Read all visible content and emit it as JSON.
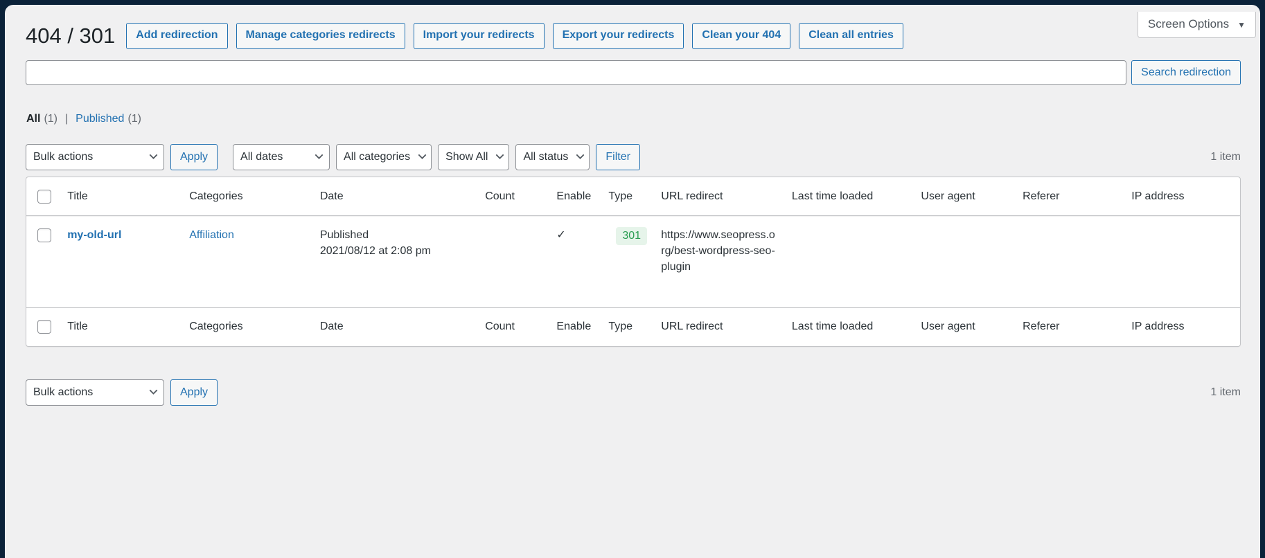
{
  "screen_options": {
    "label": "Screen Options",
    "caret_icon": "chevron-down-icon"
  },
  "header": {
    "title": "404 / 301",
    "actions": [
      "Add redirection",
      "Manage categories redirects",
      "Import your redirects",
      "Export your redirects",
      "Clean your 404",
      "Clean all entries"
    ]
  },
  "search": {
    "value": "",
    "placeholder": "",
    "button_label": "Search redirection"
  },
  "status_links": {
    "all": {
      "label": "All",
      "count": "(1)"
    },
    "separator": "|",
    "published": {
      "label": "Published",
      "count": "(1)"
    }
  },
  "tablenav_top": {
    "bulk_actions": "Bulk actions",
    "apply_label": "Apply",
    "dates": "All dates",
    "categories": "All categories",
    "show": "Show All",
    "status": "All status",
    "filter_label": "Filter",
    "displaying_num": "1 item"
  },
  "tablenav_bottom": {
    "bulk_actions": "Bulk actions",
    "apply_label": "Apply",
    "displaying_num": "1 item"
  },
  "table": {
    "columns": [
      {
        "label": "Title",
        "sortable": true
      },
      {
        "label": "Categories",
        "sortable": false
      },
      {
        "label": "Date",
        "sortable": true
      },
      {
        "label": "Count",
        "sortable": true
      },
      {
        "label": "Enable",
        "sortable": true
      },
      {
        "label": "Type",
        "sortable": true
      },
      {
        "label": "URL redirect",
        "sortable": false
      },
      {
        "label": "Last time loaded",
        "sortable": false
      },
      {
        "label": "User agent",
        "sortable": false
      },
      {
        "label": "Referer",
        "sortable": false
      },
      {
        "label": "IP address",
        "sortable": false
      }
    ],
    "rows": [
      {
        "title": "my-old-url",
        "category": "Affiliation",
        "date_status": "Published",
        "date_value": "2021/08/12 at 2:08 pm",
        "count": "",
        "enable": "✓",
        "type": "301",
        "url_redirect": "https://www.seopress.org/best-wordpress-seo-plugin",
        "last_time_loaded": "",
        "user_agent": "",
        "referer": "",
        "ip_address": ""
      }
    ]
  },
  "colors": {
    "frame": "#0b2239",
    "page_bg": "#f0f0f1",
    "link": "#2271b1",
    "text": "#1d2327",
    "muted": "#646970",
    "badge_bg": "#e6f4ea",
    "badge_text": "#2a9d52",
    "border": "#c3c4c7"
  }
}
